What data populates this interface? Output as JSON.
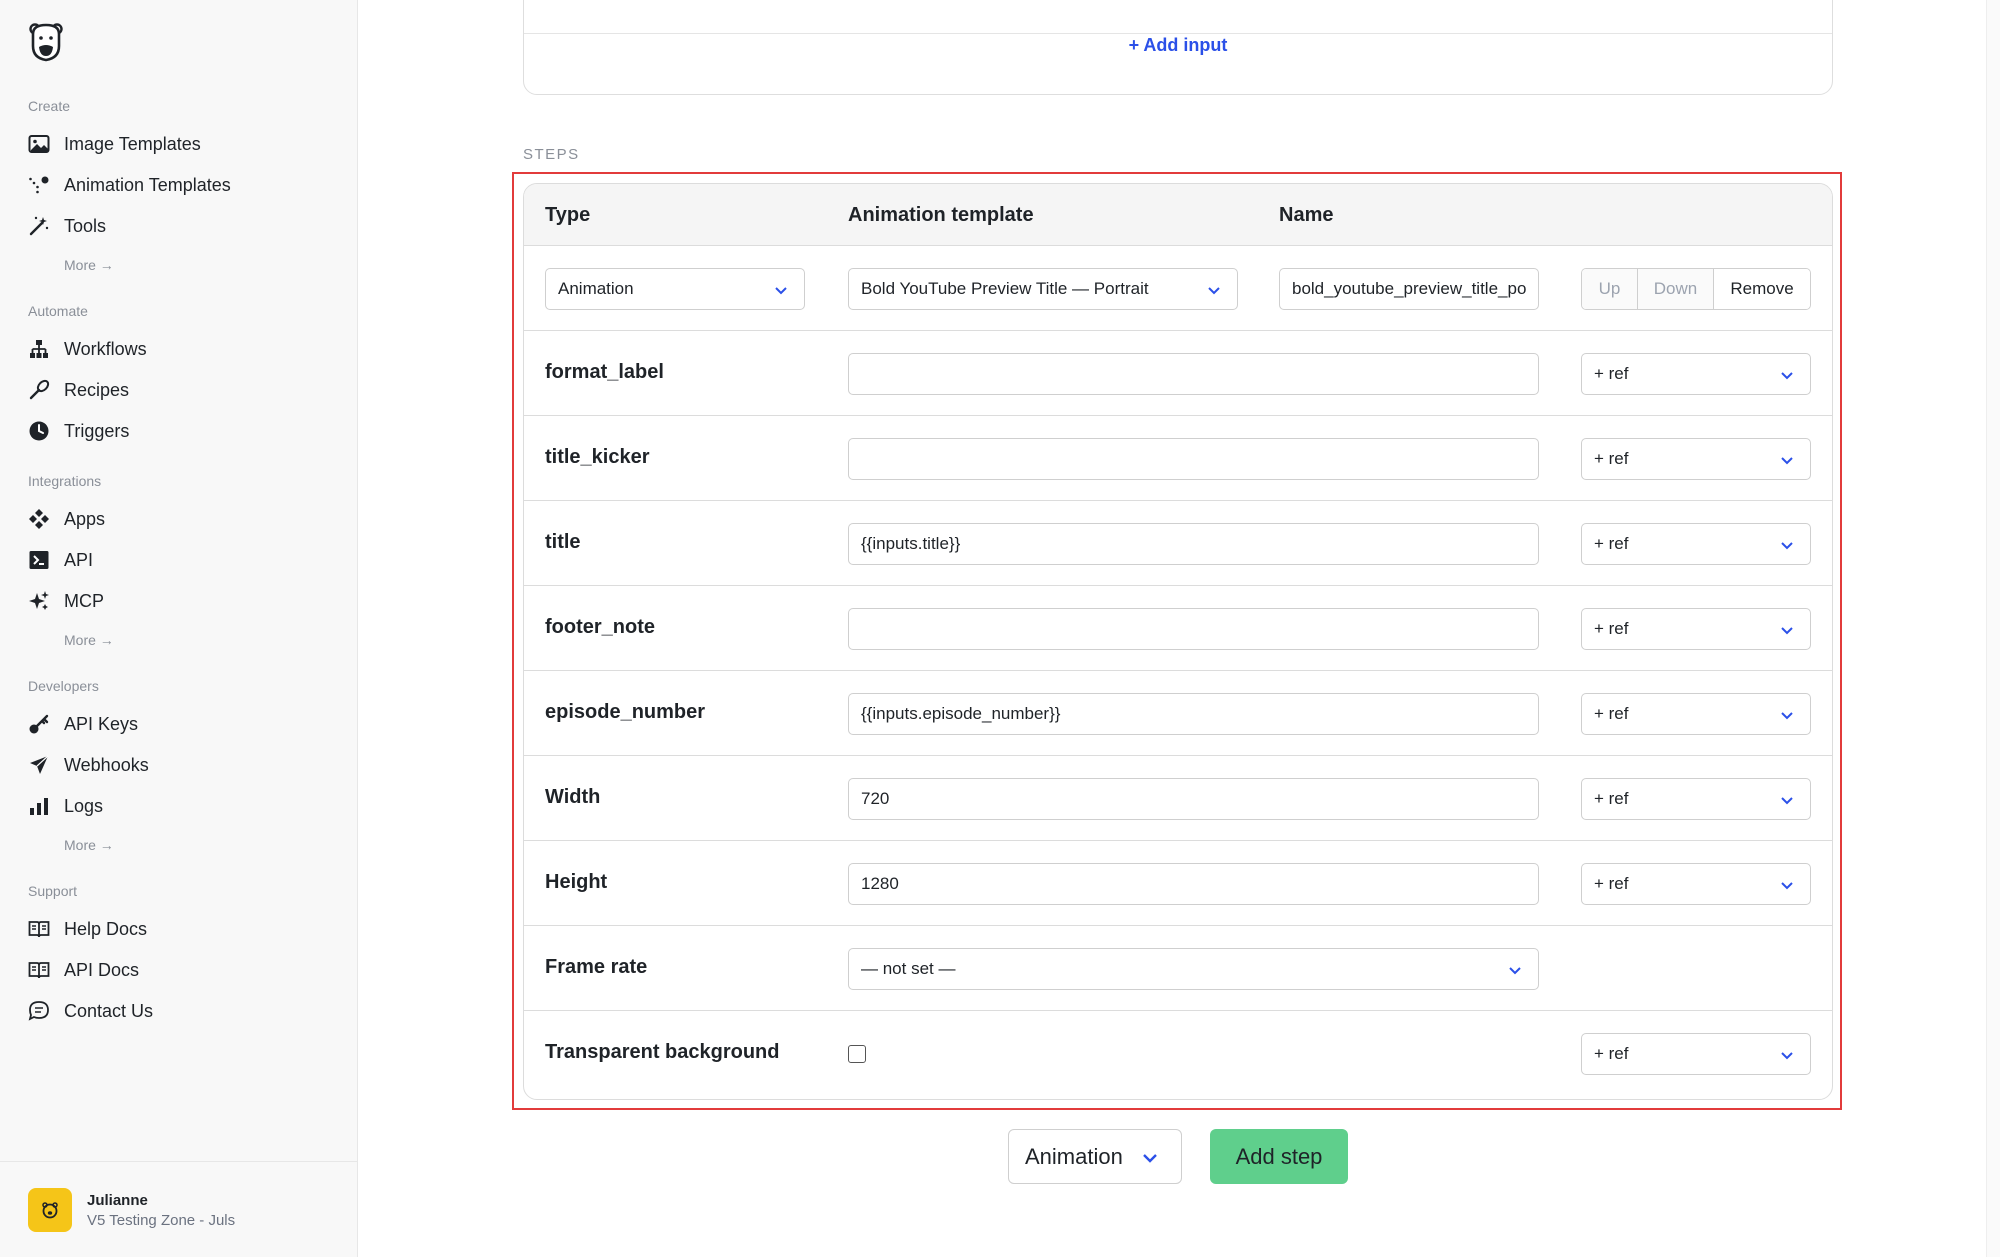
{
  "sidebar": {
    "sections": {
      "create": "Create",
      "automate": "Automate",
      "integrations": "Integrations",
      "developers": "Developers",
      "support": "Support"
    },
    "create_items": [
      "Image Templates",
      "Animation Templates",
      "Tools"
    ],
    "automate_items": [
      "Workflows",
      "Recipes",
      "Triggers"
    ],
    "integrations_items": [
      "Apps",
      "API",
      "MCP"
    ],
    "developers_items": [
      "API Keys",
      "Webhooks",
      "Logs"
    ],
    "support_items": [
      "Help Docs",
      "API Docs",
      "Contact Us"
    ],
    "more_label": "More →",
    "user": {
      "name": "Julianne",
      "org": "V5 Testing Zone - Juls"
    }
  },
  "main": {
    "add_input_label": "+ Add input",
    "steps_label": "STEPS",
    "columns": {
      "type": "Type",
      "template": "Animation template",
      "name": "Name"
    },
    "step": {
      "type_value": "Animation",
      "template_value": "Bold YouTube Preview Title — Portrait",
      "name_value": "bold_youtube_preview_title_po",
      "up_label": "Up",
      "down_label": "Down",
      "remove_label": "Remove"
    },
    "ref_label": "+ ref",
    "rows": [
      {
        "label": "format_label",
        "value": ""
      },
      {
        "label": "title_kicker",
        "value": ""
      },
      {
        "label": "title",
        "value": "{{inputs.title}}"
      },
      {
        "label": "footer_note",
        "value": ""
      },
      {
        "label": "episode_number",
        "value": "{{inputs.episode_number}}"
      },
      {
        "label": "Width",
        "value": "720"
      },
      {
        "label": "Height",
        "value": "1280"
      },
      {
        "label": "Frame rate",
        "value": "— not set —"
      },
      {
        "label": "Transparent background",
        "value": ""
      }
    ],
    "bottom": {
      "type_select": "Animation",
      "add_step_label": "Add step"
    }
  },
  "colors": {
    "accent": "#2b50e8",
    "add_step_bg": "#5fcf8c",
    "highlight": "#e23b3b",
    "avatar_bg": "#f5c518"
  }
}
